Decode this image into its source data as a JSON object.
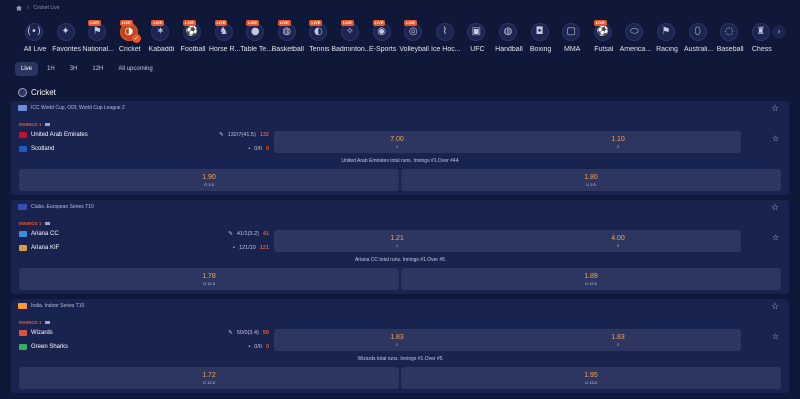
{
  "breadcrumb": {
    "sep": "/",
    "current": "Cricket Live"
  },
  "sports": [
    {
      "label": "All Live",
      "icon": "(•)",
      "live": false,
      "active": false
    },
    {
      "label": "Favorites",
      "icon": "✦",
      "live": false,
      "active": false
    },
    {
      "label": "National...",
      "icon": "⚑",
      "live": true,
      "active": false
    },
    {
      "label": "Cricket",
      "icon": "◑",
      "live": true,
      "active": true
    },
    {
      "label": "Kabaddi",
      "icon": "✶",
      "live": true,
      "active": false
    },
    {
      "label": "Football",
      "icon": "⚽",
      "live": true,
      "active": false
    },
    {
      "label": "Horse R...",
      "icon": "♞",
      "live": true,
      "active": false
    },
    {
      "label": "Table Te...",
      "icon": "●",
      "live": true,
      "active": false
    },
    {
      "label": "Basketball",
      "icon": "◍",
      "live": true,
      "active": false
    },
    {
      "label": "Tennis",
      "icon": "◐",
      "live": true,
      "active": false
    },
    {
      "label": "Badminton...",
      "icon": "✧",
      "live": true,
      "active": false
    },
    {
      "label": "E-Sports",
      "icon": "◉",
      "live": true,
      "active": false
    },
    {
      "label": "Volleyball",
      "icon": "◎",
      "live": true,
      "active": false
    },
    {
      "label": "Ice Hoc...",
      "icon": "⌇",
      "live": false,
      "active": false
    },
    {
      "label": "UFC",
      "icon": "▣",
      "live": false,
      "active": false
    },
    {
      "label": "Handball",
      "icon": "◍",
      "live": false,
      "active": false
    },
    {
      "label": "Boxing",
      "icon": "◘",
      "live": false,
      "active": false
    },
    {
      "label": "MMA",
      "icon": "▢",
      "live": false,
      "active": false
    },
    {
      "label": "Futsal",
      "icon": "⚽",
      "live": true,
      "active": false
    },
    {
      "label": "America...",
      "icon": "⬭",
      "live": false,
      "active": false
    },
    {
      "label": "Racing",
      "icon": "⚑",
      "live": false,
      "active": false
    },
    {
      "label": "Australi...",
      "icon": "⬯",
      "live": false,
      "active": false
    },
    {
      "label": "Baseball",
      "icon": "◌",
      "live": false,
      "active": false
    },
    {
      "label": "Chess",
      "icon": "♜",
      "live": false,
      "active": false
    }
  ],
  "live_badge": "LIVE",
  "next_icon": "›",
  "filters": [
    "Live",
    "1H",
    "3H",
    "12H",
    "All upcoming"
  ],
  "section_title": "Cricket",
  "star_icon": "☆",
  "matches": [
    {
      "league": "ICC World Cup, ODI, World Cup League 2",
      "league_flag": "#6a8fd6",
      "innings": "INNINGS 1",
      "team1": {
        "name": "United Arab Emirates",
        "flag": "#c8102e",
        "score": "132/7(41.5)",
        "runs": "132"
      },
      "team2": {
        "name": "Scotland",
        "flag": "#1e5bc6",
        "score": "0/0",
        "runs": "0"
      },
      "odds1": {
        "value": "7.00",
        "key": "1"
      },
      "odds2": {
        "value": "1.10",
        "key": "2"
      },
      "market": "United Arab Emirates total runs. Innings #1.Over #44",
      "over": {
        "value": "1.90",
        "key": "O 3.5"
      },
      "under": {
        "value": "1.80",
        "key": "U 3.5"
      }
    },
    {
      "league": "Clubs. European Series T10",
      "league_flag": "#3451b2",
      "innings": "INNINGS 1",
      "team1": {
        "name": "Ariana CC",
        "flag": "#3c8fd6",
        "score": "41/1(3.2)",
        "runs": "41"
      },
      "team2": {
        "name": "Ariana KIF",
        "flag": "#d6a13c",
        "score": "121/10",
        "runs": "121"
      },
      "odds1": {
        "value": "1.21",
        "key": "1"
      },
      "odds2": {
        "value": "4.00",
        "key": "2"
      },
      "market": "Ariana CC total runs. Innings #1.Over #5",
      "over": {
        "value": "1.78",
        "key": "O 12.5"
      },
      "under": {
        "value": "1.89",
        "key": "U 12.5"
      }
    },
    {
      "league": "India. Indoor Series T10",
      "league_flag": "#ff9933",
      "innings": "INNINGS 1",
      "team1": {
        "name": "Wizards",
        "flag": "#d6553c",
        "score": "50/0(3.4)",
        "runs": "50"
      },
      "team2": {
        "name": "Green Sharks",
        "flag": "#3cab5a",
        "score": "0/0",
        "runs": "0"
      },
      "odds1": {
        "value": "1.83",
        "key": "1"
      },
      "odds2": {
        "value": "1.83",
        "key": "2"
      },
      "market": "Wizards total runs. Innings #1.Over #5",
      "over": {
        "value": "1.72",
        "key": "O 13.5"
      },
      "under": {
        "value": "1.95",
        "key": "U 13.5"
      }
    }
  ]
}
